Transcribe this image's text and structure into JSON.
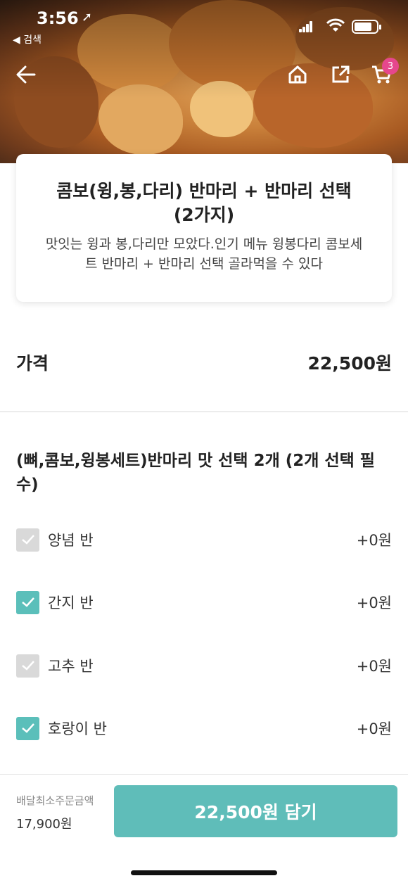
{
  "status_bar": {
    "time": "3:56",
    "back_app": "◀ 검색"
  },
  "nav": {
    "cart_count": "3"
  },
  "product": {
    "title": "콤보(윙,봉,다리) 반마리 + 반마리 선택 (2가지)",
    "description": "맛잇는 윙과 봉,다리만 모았다.인기 메뉴 윙봉다리 콤보세트 반마리 + 반마리 선택 골라먹을 수 있다"
  },
  "price": {
    "label": "가격",
    "value": "22,500원"
  },
  "options": {
    "title": "(뼈,콤보,윙봉세트)반마리 맛 선택 2개 (2개 선택 필수)",
    "items": [
      {
        "label": "양념 반",
        "price": "+0원",
        "checked": false
      },
      {
        "label": "간지 반",
        "price": "+0원",
        "checked": true
      },
      {
        "label": "고추 반",
        "price": "+0원",
        "checked": false
      },
      {
        "label": "호랑이 반",
        "price": "+0원",
        "checked": true
      }
    ]
  },
  "bottom_bar": {
    "min_order_label": "배달최소주문금액",
    "min_order_value": "17,900원",
    "cta_label": "22,500원 담기"
  },
  "colors": {
    "accent": "#5fbdb9",
    "badge": "#e6478d",
    "checkbox_off": "#d9d9d9"
  }
}
